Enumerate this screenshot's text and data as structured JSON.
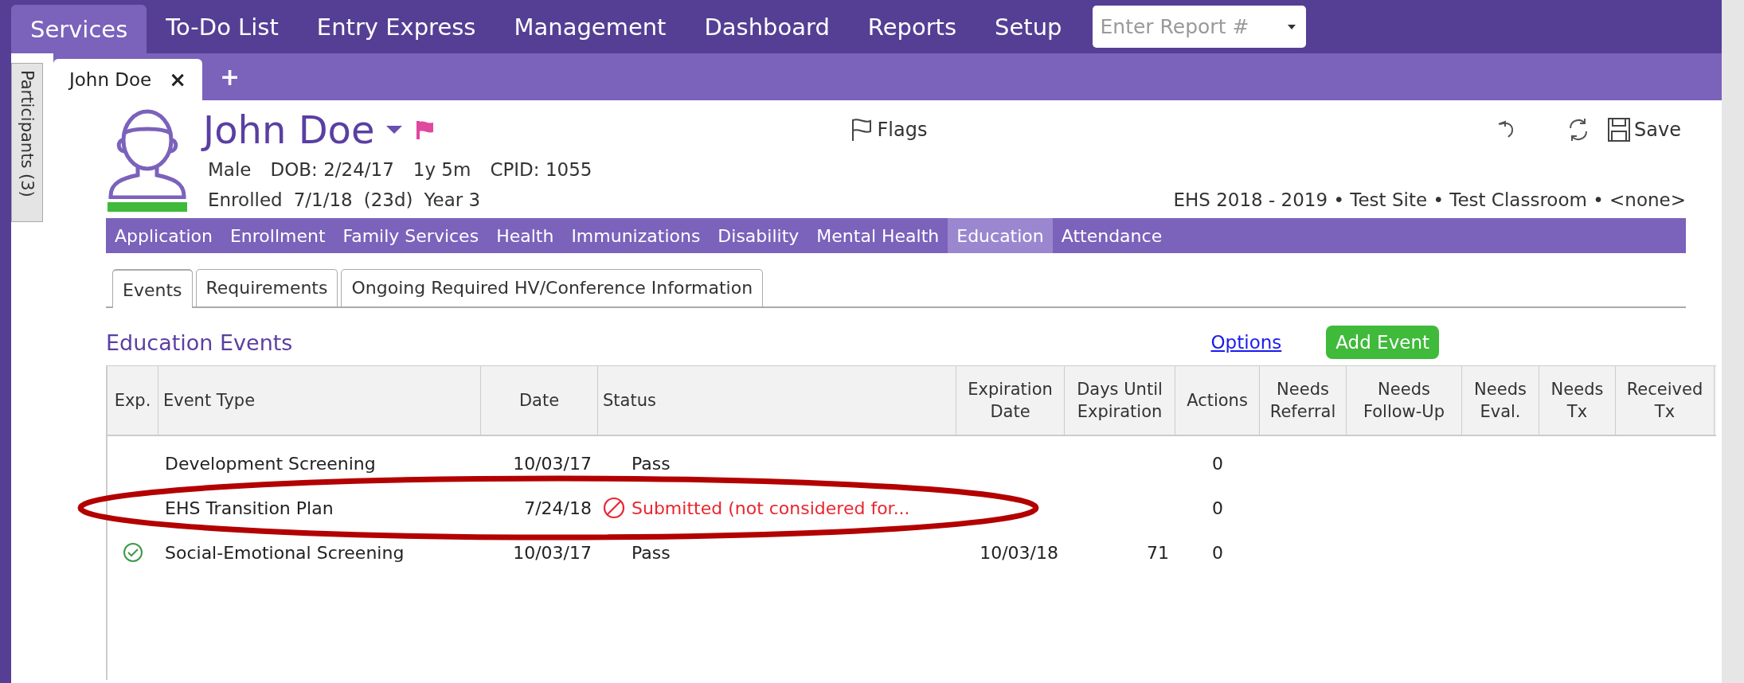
{
  "menu": [
    {
      "label": "Services",
      "selected": true
    },
    {
      "label": "To-Do List",
      "selected": false
    },
    {
      "label": "Entry Express",
      "selected": false
    },
    {
      "label": "Management",
      "selected": false
    },
    {
      "label": "Dashboard",
      "selected": false
    },
    {
      "label": "Reports",
      "selected": false
    },
    {
      "label": "Setup",
      "selected": false
    }
  ],
  "report_field": {
    "placeholder": "Enter Report #"
  },
  "side_tab": "Participants (3)",
  "doc_tabs": [
    {
      "label": "John Doe",
      "selected": true,
      "close": "×"
    }
  ],
  "new_tab": "+",
  "participant": {
    "name": "John Doe",
    "flagged": true,
    "gender": "Male",
    "dob": "DOB: 2/24/17",
    "age": "1y 5m",
    "cpid": "CPID: 1055",
    "enrolled": "Enrolled",
    "enrolled_date": "7/1/18",
    "enrolled_days": "(23d)",
    "year": "Year 3",
    "program": "EHS 2018 - 2019 • Test Site • Test Classroom • <none>"
  },
  "toolbar": {
    "flags": "Flags",
    "save": "Save"
  },
  "sections": [
    {
      "label": "Application",
      "selected": false
    },
    {
      "label": "Enrollment",
      "selected": false
    },
    {
      "label": "Family Services",
      "selected": false
    },
    {
      "label": "Health",
      "selected": false
    },
    {
      "label": "Immunizations",
      "selected": false
    },
    {
      "label": "Disability",
      "selected": false
    },
    {
      "label": "Mental Health",
      "selected": false
    },
    {
      "label": "Education",
      "selected": true
    },
    {
      "label": "Attendance",
      "selected": false
    }
  ],
  "sub_tabs": [
    {
      "label": "Events",
      "selected": true
    },
    {
      "label": "Requirements",
      "selected": false
    },
    {
      "label": "Ongoing Required HV/Conference Information",
      "selected": false
    }
  ],
  "events": {
    "title": "Education Events",
    "options": "Options",
    "add": "Add Event",
    "columns": [
      [
        "Exp."
      ],
      [
        "Event Type"
      ],
      [
        "Date"
      ],
      [
        "Status"
      ],
      [
        "Expiration",
        "Date"
      ],
      [
        "Days Until",
        "Expiration"
      ],
      [
        "Actions"
      ],
      [
        "Needs",
        "Referral"
      ],
      [
        "Needs",
        "Follow-Up"
      ],
      [
        "Needs",
        "Eval."
      ],
      [
        "Needs",
        "Tx"
      ],
      [
        "Received",
        "Tx"
      ]
    ],
    "rows": [
      {
        "exp_ok": false,
        "highlighted": false,
        "event_type": "Development Screening",
        "date": "10/03/17",
        "status": "Pass",
        "excluded": false,
        "actions": "0"
      },
      {
        "exp_ok": false,
        "highlighted": true,
        "event_type": "EHS Transition Plan",
        "date": "7/24/18",
        "status": "Submitted (not considered for...",
        "excluded": true,
        "actions": "0"
      },
      {
        "exp_ok": true,
        "highlighted": false,
        "event_type": "Social-Emotional Screening",
        "date": "10/03/17",
        "status": "Pass",
        "excluded": false,
        "expiration_date": "10/03/18",
        "days_until": "71",
        "actions": "0"
      }
    ]
  }
}
